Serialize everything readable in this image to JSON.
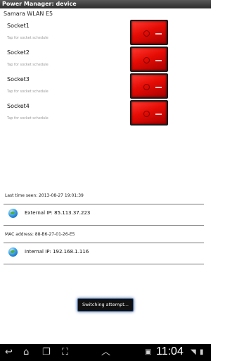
{
  "app": {
    "title": "Power Manager: device"
  },
  "device": {
    "name": "Samara WLAN E5"
  },
  "sockets": [
    {
      "name": "Socket1",
      "hint": "Tap for socket schedule"
    },
    {
      "name": "Socket2",
      "hint": "Tap for socket schedule"
    },
    {
      "name": "Socket3",
      "hint": "Tap for socket schedule"
    },
    {
      "name": "Socket4",
      "hint": "Tap for socket schedule"
    }
  ],
  "status": {
    "last_seen": "Last time seen: 2013-08-27 19:01:39",
    "external_ip": "External IP: 85.113.37.223",
    "mac": "MAC address: 88-B6-27-01-26-E5",
    "internal_ip": "Internal IP: 192.168.1.116"
  },
  "toast": {
    "text": "Switching attempt..."
  },
  "navbar": {
    "clock": "11:04",
    "icons": [
      "back-icon",
      "home-icon",
      "recent-apps-icon",
      "screenshot-icon",
      "up-chevron-icon",
      "notification-icon",
      "wifi-icon",
      "battery-icon"
    ]
  }
}
